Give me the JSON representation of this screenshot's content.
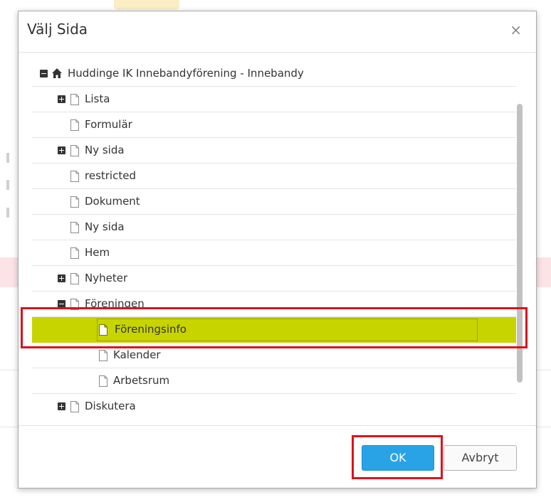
{
  "dialog": {
    "title": "Välj Sida",
    "close_glyph": "×",
    "ok_label": "OK",
    "cancel_label": "Avbryt"
  },
  "tree": {
    "root": {
      "label": "Huddinge IK Innebandyförening - Innebandy",
      "icon": "home-icon",
      "expanded": true
    },
    "items": [
      {
        "label": "Lista",
        "level": 1,
        "toggle": "plus"
      },
      {
        "label": "Formulär",
        "level": 1,
        "toggle": "none"
      },
      {
        "label": "Ny sida",
        "level": 1,
        "toggle": "plus"
      },
      {
        "label": "restricted",
        "level": 1,
        "toggle": "none"
      },
      {
        "label": "Dokument",
        "level": 1,
        "toggle": "none"
      },
      {
        "label": "Ny sida",
        "level": 1,
        "toggle": "none"
      },
      {
        "label": "Hem",
        "level": 1,
        "toggle": "none"
      },
      {
        "label": "Nyheter",
        "level": 1,
        "toggle": "plus"
      },
      {
        "label": "Föreningen",
        "level": 1,
        "toggle": "minus"
      },
      {
        "label": "Föreningsinfo",
        "level": 2,
        "toggle": "none",
        "selected": true
      },
      {
        "label": "Kalender",
        "level": 2,
        "toggle": "none"
      },
      {
        "label": "Arbetsrum",
        "level": 2,
        "toggle": "none"
      },
      {
        "label": "Diskutera",
        "level": 1,
        "toggle": "plus"
      }
    ]
  },
  "colors": {
    "selected_row": "#c8d400",
    "highlight_outline": "#d8141c",
    "ok_button": "#29a3e6"
  }
}
